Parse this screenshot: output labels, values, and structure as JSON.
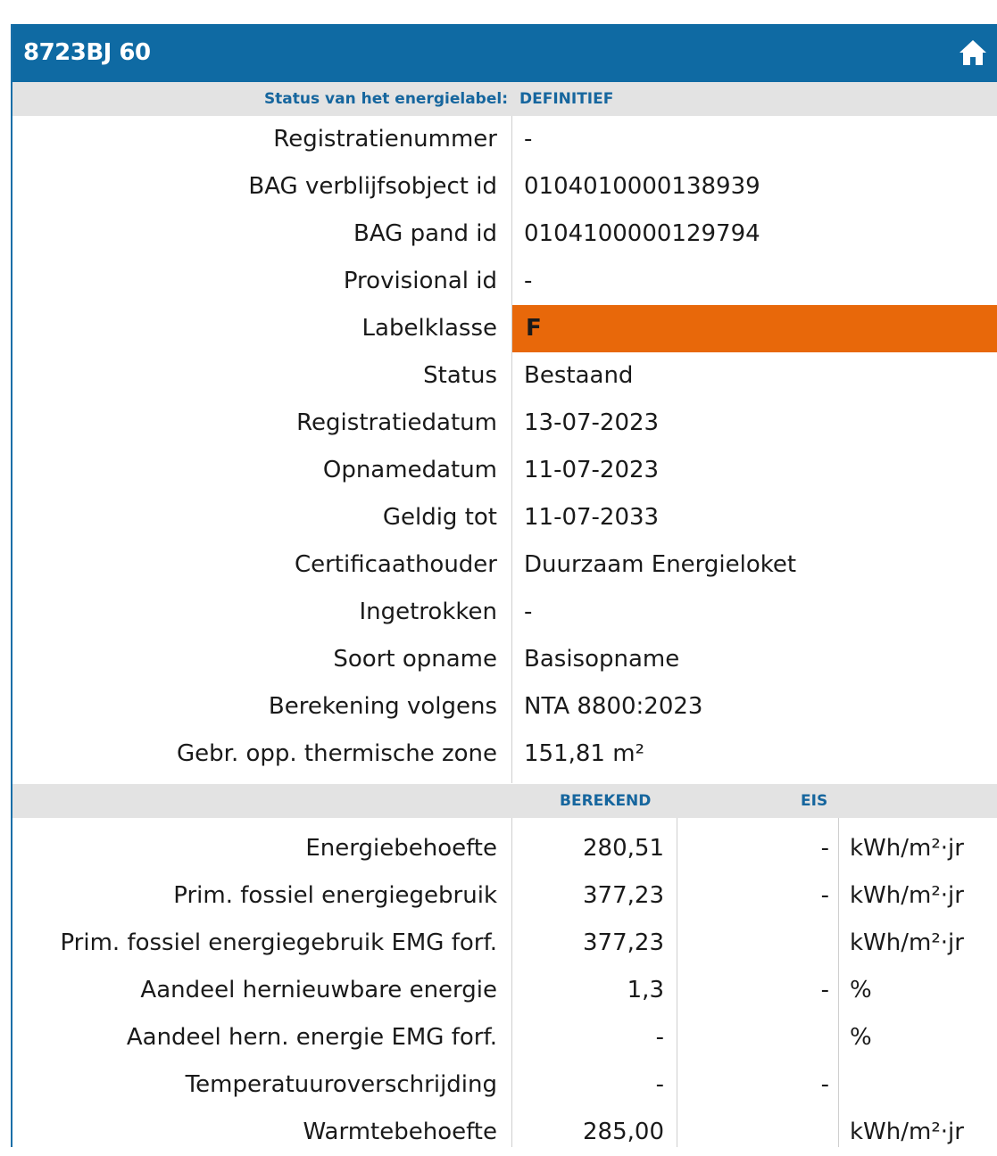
{
  "header": {
    "title": "8723BJ 60",
    "home_icon": "home-icon"
  },
  "status_bar": {
    "label": "Status van het energielabel:",
    "value": "DEFINITIEF"
  },
  "details": [
    {
      "label": "Registratienummer",
      "value": "-"
    },
    {
      "label": "BAG verblijfsobject id",
      "value": "0104010000138939"
    },
    {
      "label": "BAG pand id",
      "value": "0104100000129794"
    },
    {
      "label": "Provisional id",
      "value": "-"
    },
    {
      "label": "Labelklasse",
      "value": "F"
    },
    {
      "label": "Status",
      "value": "Bestaand"
    },
    {
      "label": "Registratiedatum",
      "value": "13-07-2023"
    },
    {
      "label": "Opnamedatum",
      "value": "11-07-2023"
    },
    {
      "label": "Geldig tot",
      "value": "11-07-2033"
    },
    {
      "label": "Certificaathouder",
      "value": "Duurzaam Energieloket"
    },
    {
      "label": "Ingetrokken",
      "value": "-"
    },
    {
      "label": "Soort opname",
      "value": "Basisopname"
    },
    {
      "label": "Berekening volgens",
      "value": "NTA 8800:2023"
    },
    {
      "label": "Gebr. opp. thermische zone",
      "value": "151,81 m²"
    }
  ],
  "calc_header": {
    "berekend": "BEREKEND",
    "eis": "EIS"
  },
  "calc": [
    {
      "label": "Energiebehoefte",
      "berekend": "280,51",
      "eis": "-",
      "unit": "kWh/m²·jr"
    },
    {
      "label": "Prim. fossiel energiegebruik",
      "berekend": "377,23",
      "eis": "-",
      "unit": "kWh/m²·jr"
    },
    {
      "label": "Prim. fossiel energiegebruik EMG forf.",
      "berekend": "377,23",
      "eis": "",
      "unit": "kWh/m²·jr"
    },
    {
      "label": "Aandeel hernieuwbare energie",
      "berekend": "1,3",
      "eis": "-",
      "unit": "%"
    },
    {
      "label": "Aandeel hern. energie EMG forf.",
      "berekend": "-",
      "eis": "",
      "unit": "%"
    },
    {
      "label": "Temperatuuroverschrijding",
      "berekend": "-",
      "eis": "-",
      "unit": ""
    },
    {
      "label": "Warmtebehoefte",
      "berekend": "285,00",
      "eis": "",
      "unit": "kWh/m²·jr"
    }
  ],
  "colors": {
    "header": "#0f6aa3",
    "band": "#e3e3e3",
    "band_text": "#16669e",
    "label_f": "#e8680a"
  }
}
